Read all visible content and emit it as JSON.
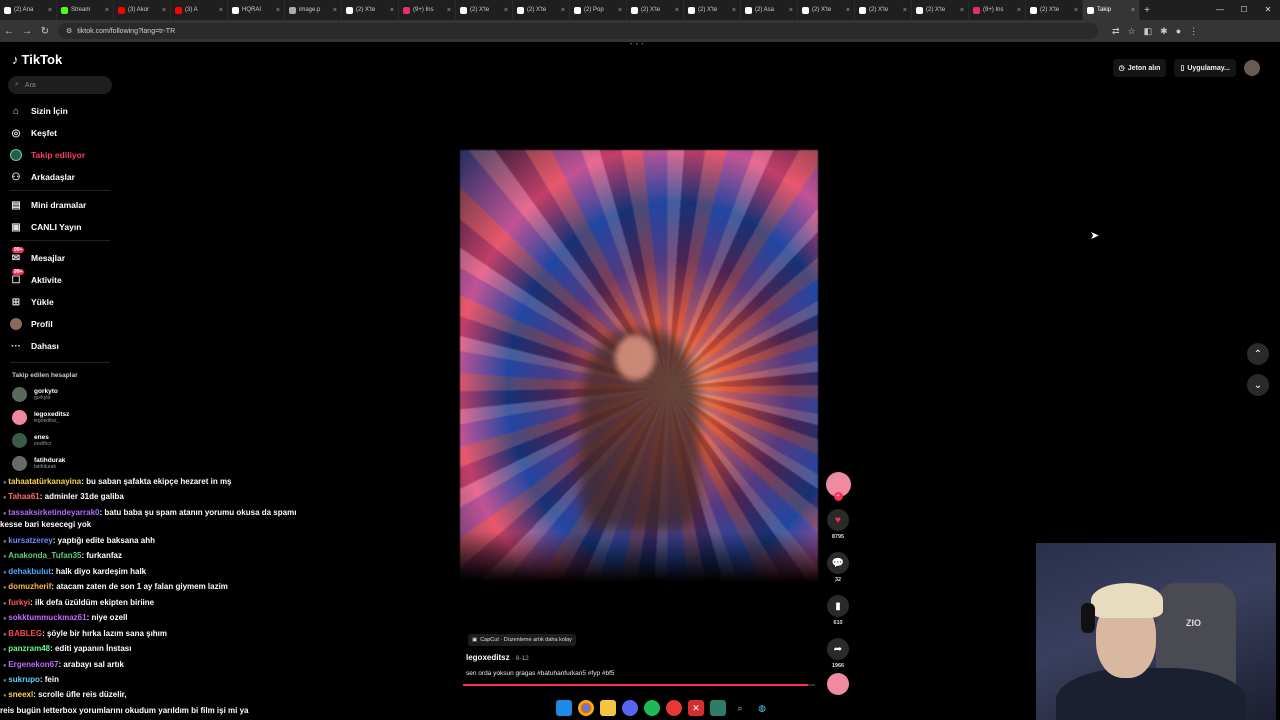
{
  "browser": {
    "tabs": [
      {
        "label": "(2) Ana",
        "color": "#ffffff"
      },
      {
        "label": "Stream",
        "color": "#53fc18"
      },
      {
        "label": "(3) Akor",
        "color": "#ff0000"
      },
      {
        "label": "(3) A",
        "color": "#ff0000"
      },
      {
        "label": "HQRAI",
        "color": "#ffffff"
      },
      {
        "label": "image.p",
        "color": "#aaaaaa"
      },
      {
        "label": "(2) X'te",
        "color": "#ffffff"
      },
      {
        "label": "(9+) Ins",
        "color": "#e1306c"
      },
      {
        "label": "(2) X'te",
        "color": "#ffffff"
      },
      {
        "label": "(2) X'te",
        "color": "#ffffff"
      },
      {
        "label": "(2) Pop",
        "color": "#ffffff"
      },
      {
        "label": "(2) X'te",
        "color": "#ffffff"
      },
      {
        "label": "(2) X'te",
        "color": "#ffffff"
      },
      {
        "label": "(2) Asa",
        "color": "#ffffff"
      },
      {
        "label": "(2) X'te",
        "color": "#ffffff"
      },
      {
        "label": "(2) X'te",
        "color": "#ffffff"
      },
      {
        "label": "(2) X'te",
        "color": "#ffffff"
      },
      {
        "label": "(9+) Ins",
        "color": "#e1306c"
      },
      {
        "label": "(2) X'te",
        "color": "#ffffff"
      },
      {
        "label": "Takip",
        "color": "#ffffff"
      }
    ],
    "url": "tiktok.com/following?lang=tr-TR"
  },
  "tiktok": {
    "logo": "TikTok",
    "search_placeholder": "Ara",
    "nav": {
      "for_you": "Sizin İçin",
      "explore": "Keşfet",
      "following": "Takip ediliyor",
      "friends": "Arkadaşlar",
      "mini_dramas": "Mini dramalar",
      "live": "CANLI Yayın",
      "messages": "Mesajlar",
      "activity": "Aktivite",
      "upload": "Yükle",
      "profile": "Profil",
      "more": "Dahası",
      "badge": "99+"
    },
    "following_title": "Takip edilen hesaplar",
    "accounts": [
      {
        "name": "gorkyto",
        "handle": "gorkyto",
        "color": "#5a6a5a"
      },
      {
        "name": "legoxeditsz",
        "handle": "legoeditsz_",
        "color": "#f08aa0"
      },
      {
        "name": "enes",
        "handle": "enslthcr",
        "color": "#3a5a4a"
      },
      {
        "name": "fatihdurak",
        "handle": "fatihdurak",
        "color": "#6a6a6a"
      }
    ],
    "top_right": {
      "coins": "Jeton alın",
      "app": "Uygulamay..."
    },
    "video": {
      "capcut": "CapCut · Düzenleme artık daha kolay",
      "author": "legoxeditsz",
      "date": "· 8-12",
      "caption": "sen orda yoksun gragas #batuhanfurkan5 #fyp #bf5",
      "progress": 0.98,
      "likes": "8795",
      "comments": "32",
      "saves": "610",
      "shares": "1966"
    }
  },
  "chat": [
    {
      "user": "tahaatatürkanayina",
      "text": ": bu saban şafakta ekipçe hezaret in mş",
      "color": "#ffd54a"
    },
    {
      "user": "Tahaa61",
      "text": ": adminler 31de galiba",
      "color": "#ff6b6b"
    },
    {
      "user": "tassaksirketindeyarrak0",
      "text": ": batu baba şu spam atanın yorumu okusa da spamı",
      "color": "#b06bff"
    },
    {
      "user": "",
      "text": "kesse bari kesecegi yok",
      "color": "#ffffff"
    },
    {
      "user": "kursatzerey",
      "text": ": yaptığı edite baksana ahh",
      "color": "#6b8bff"
    },
    {
      "user": "Anakonda_Tufan35",
      "text": ": furkanfaz",
      "color": "#5bd17a"
    },
    {
      "user": "dehakbulut",
      "text": ": halk diyo kardeşim halk",
      "color": "#4aa8ff"
    },
    {
      "user": "domuzherif",
      "text": ": atacam zaten de son 1 ay falan giymem lazim",
      "color": "#ffb84a"
    },
    {
      "user": "furkyi",
      "text": ": ilk defa üzüldüm ekipten biriine",
      "color": "#ff5a5a"
    },
    {
      "user": "sokktummuckmaz61",
      "text": ": niye ozell",
      "color": "#c36bff"
    },
    {
      "user": "BABLEG",
      "text": ": şöyle bir hırka lazım sana şıhım",
      "color": "#ff4a4a"
    },
    {
      "user": "panzram48",
      "text": ": editi yapanın İnstası",
      "color": "#5bff8a"
    },
    {
      "user": "Ergenekon67",
      "text": ": arabayı sal artık",
      "color": "#c36bff"
    },
    {
      "user": "sukrupo",
      "text": ": fein",
      "color": "#5bd1ff"
    },
    {
      "user": "sneexl",
      "text": ": scrolle üfle reis düzelir,",
      "color": "#ffd54a"
    },
    {
      "user": "",
      "text": "reis bugün letterbox yorumlarını okudum yarıldım bi film işi mi ya",
      "color": "#ffffff"
    }
  ],
  "webcam": {
    "chair_label": "ZIO"
  }
}
